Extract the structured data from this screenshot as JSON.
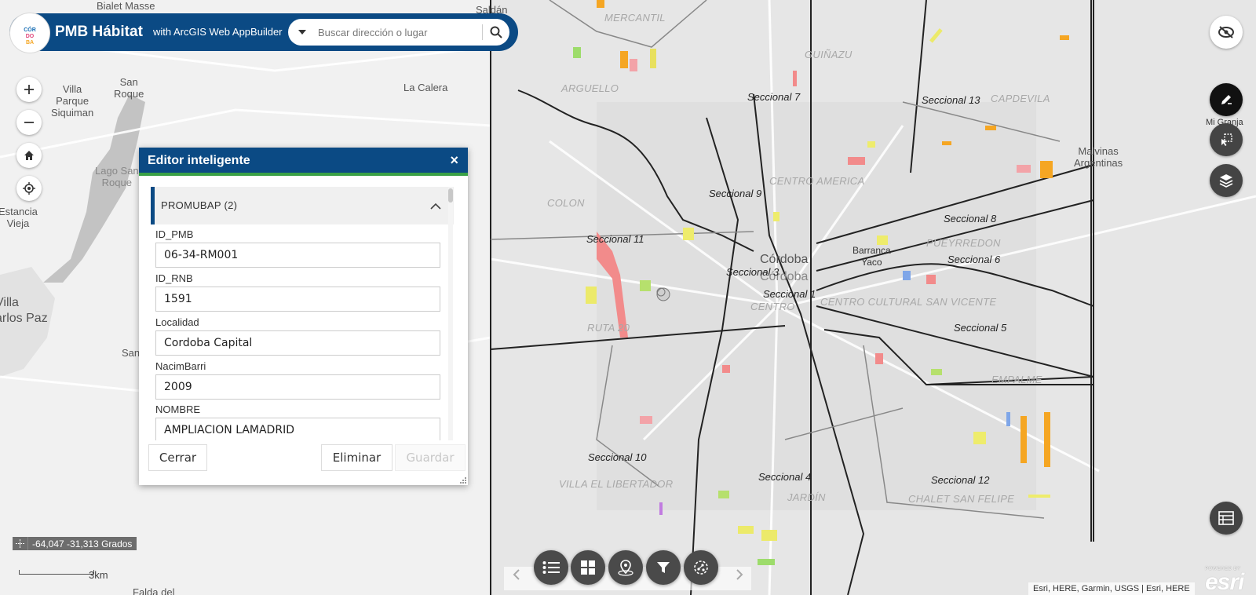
{
  "header": {
    "logo_text": "CÓRDOBA",
    "title": "PMB Hábitat",
    "subtitle": "with ArcGIS Web AppBuilder",
    "search_placeholder": "Buscar dirección o lugar"
  },
  "map": {
    "places": {
      "bialet_masse": "Bialet Masse",
      "saldan": "Saldán",
      "villa_parque_siquiman": "Villa\nParque\nSiquiman",
      "san_roque": "San\nRoque",
      "la_calera": "La Calera",
      "lago_san_roque": "Lago San\nRoque",
      "estancia_vieja": "Estancia\nVieja",
      "villa_carlos_paz": "Villa\narlos Paz",
      "san": "San",
      "falda_del": "Falda del",
      "malvinas_argentinas": "Malvinas\nArgentinas",
      "cordoba": "Córdoba",
      "cordoba2": "Córdoba",
      "barranca_yaco": "Barranca\nYaco"
    },
    "seccionales": {
      "s7": "Seccional 7",
      "s13": "Seccional 13",
      "s9": "Seccional 9",
      "s11": "Seccional 11",
      "s8": "Seccional 8",
      "s6": "Seccional 6",
      "s3": "Seccional 3",
      "s1": "Seccional 1",
      "s5": "Seccional 5",
      "s10": "Seccional 10",
      "s4": "Seccional 4",
      "s12": "Seccional 12"
    },
    "barrios": {
      "mercantil": "MERCANTIL",
      "guinazu": "GUIÑAZU",
      "arguello": "ARGUELLO",
      "capdevila": "CAPDEVILA",
      "centro_america": "CENTRO AMERICA",
      "colon": "COLON",
      "pueyrredon": "PUEYRREDON",
      "centro": "CENTRO",
      "centro_cultural": "CENTRO CULTURAL SAN VICENTE",
      "ruta20": "RUTA 20",
      "empalme": "EMPALME",
      "villa_libertador": "VILLA EL LIBERTADOR",
      "jardin": "JARDÍN",
      "chalet_san_felipe": "CHALET SAN FELIPE"
    },
    "coords_text": "-64,047 -31,313 Grados",
    "scale_label": "3km",
    "attribution": "Esri, HERE, Garmin, USGS | Esri, HERE",
    "esri_powered": "POWERED BY",
    "esri_word": "esri",
    "mi_granja_label": "Mi Granja"
  },
  "editor": {
    "title": "Editor inteligente",
    "close": "×",
    "layer_title": "PROMUBAP (2)",
    "fields": [
      {
        "label": "ID_PMB",
        "value": "06-34-RM001"
      },
      {
        "label": "ID_RNB",
        "value": "1591"
      },
      {
        "label": "Localidad",
        "value": "Cordoba Capital"
      },
      {
        "label": "NacimBarri",
        "value": "2009"
      },
      {
        "label": "NOMBRE",
        "value": "AMPLIACION LAMADRID"
      }
    ],
    "buttons": {
      "close": "Cerrar",
      "delete": "Eliminar",
      "save": "Guardar"
    }
  },
  "colors": {
    "brand": "#0b4a84",
    "accent_green": "#3aa046",
    "dark_button": "#4a4a4a"
  },
  "icons": {
    "toolbar": [
      "list-icon",
      "grid-icon",
      "location-icon",
      "filter-icon",
      "analysis-icon"
    ],
    "right": [
      "hide-eye-icon",
      "edit-pen-icon",
      "select-icon",
      "layers-icon",
      "table-icon"
    ]
  }
}
